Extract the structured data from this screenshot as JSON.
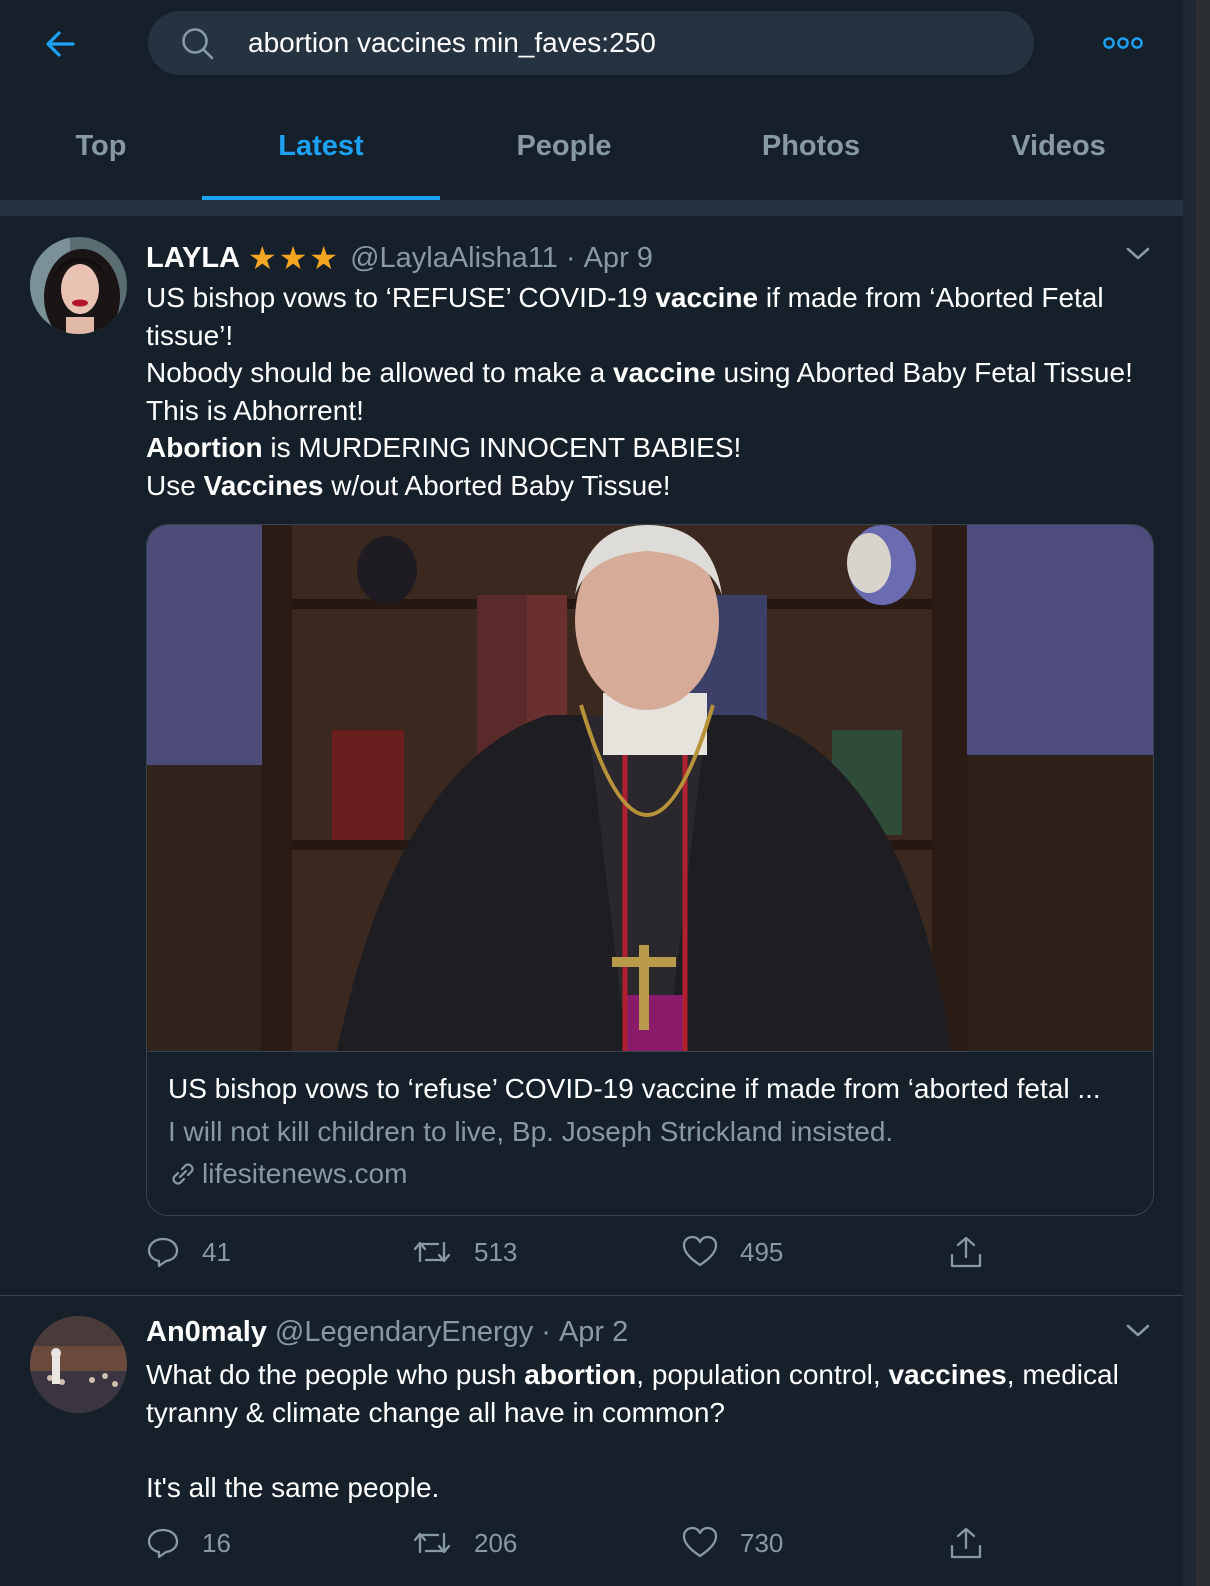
{
  "search": {
    "query": "abortion vaccines min_faves:250"
  },
  "tabs": [
    {
      "label": "Top",
      "active": false
    },
    {
      "label": "Latest",
      "active": true
    },
    {
      "label": "People",
      "active": false
    },
    {
      "label": "Photos",
      "active": false
    },
    {
      "label": "Videos",
      "active": false
    }
  ],
  "icons": {
    "back": "arrow-left-icon",
    "search": "search-icon",
    "more": "more-dots-icon",
    "reply": "reply-icon",
    "retweet": "retweet-icon",
    "like": "heart-icon",
    "share": "share-icon",
    "link": "link-icon",
    "chevron": "chevron-down-icon"
  },
  "colors": {
    "accent": "#1da1f2",
    "background": "#15202b",
    "secondary_text": "#8899a6",
    "star": "#f4a623"
  },
  "tweets": [
    {
      "name": "LAYLA",
      "badge": "★★★",
      "handle": "@LaylaAlisha11",
      "dot": "·",
      "date": "Apr 9",
      "lines": [
        {
          "a": "US bishop vows to ‘REFUSE’ COVID-19 ",
          "b": "vaccine",
          "c": " if made from ‘Aborted Fetal tissue’!"
        },
        {
          "a": "Nobody should be allowed to make a ",
          "b": "vaccine",
          "c": " using Aborted Baby Fetal Tissue! This is Abhorrent!"
        },
        {
          "a": "",
          "b": "Abortion",
          "c": " is MURDERING INNOCENT BABIES!"
        },
        {
          "a": "Use ",
          "b": "Vaccines",
          "c": " w/out Aborted Baby Tissue!"
        }
      ],
      "card": {
        "title": "US bishop vows to ‘refuse’ COVID-19 vaccine if made from ‘aborted fetal ...",
        "description": "I will not kill children to live, Bp. Joseph Strickland insisted.",
        "domain": "lifesitenews.com"
      },
      "replies": "41",
      "retweets": "513",
      "likes": "495"
    },
    {
      "name": "An0maly",
      "handle": "@LegendaryEnergy",
      "dot": "·",
      "date": "Apr 2",
      "line1": {
        "a": "What do the people who push ",
        "b": "abortion",
        "c": ", population control, ",
        "d": "vaccines",
        "e": ", medical tyranny & climate change all have in common?"
      },
      "line2": "It's all the same people.",
      "replies": "16",
      "retweets": "206",
      "likes": "730"
    }
  ]
}
